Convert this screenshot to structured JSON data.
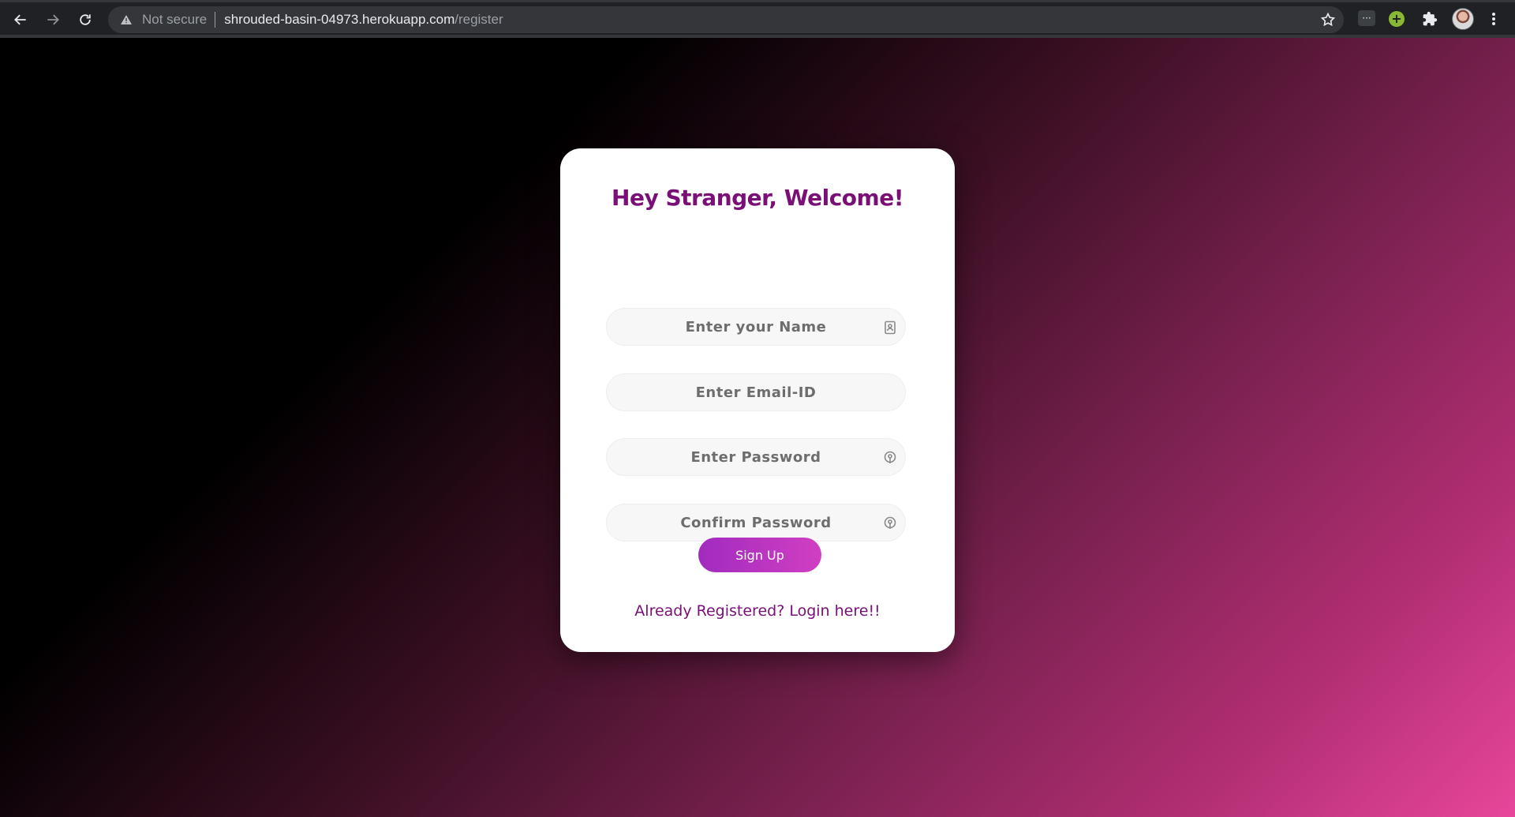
{
  "browser": {
    "security_label": "Not secure",
    "url_host": "shrouded-basin-04973.herokuapp.com",
    "url_path": "/register",
    "icons": [
      "back-icon",
      "forward-icon",
      "reload-icon",
      "warning-icon",
      "star-icon",
      "tab-search-icon",
      "add-extension-icon",
      "puzzle-icon",
      "profile-avatar",
      "menu-dots-icon"
    ],
    "ext_tab_label": "···",
    "ext_plus_label": "+"
  },
  "form": {
    "title": "Hey Stranger, Welcome!",
    "name_placeholder": "Enter your Name",
    "email_placeholder": "Enter Email-ID",
    "password_placeholder": "Enter Password",
    "confirm_placeholder": "Confirm Password",
    "submit_label": "Sign Up",
    "login_link": "Already Registered? Login here!!"
  },
  "colors": {
    "accent": "#7a0f78",
    "button_gradient_start": "#a12bbf",
    "button_gradient_end": "#d13fc2",
    "background_end": "#e8469a"
  }
}
